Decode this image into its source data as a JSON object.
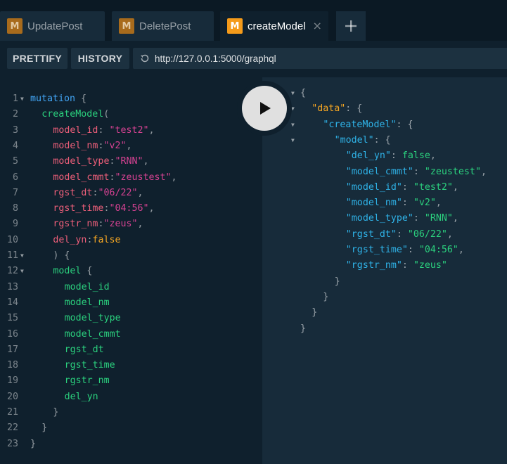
{
  "tabs": [
    {
      "badge": "M",
      "label": "UpdatePost"
    },
    {
      "badge": "M",
      "label": "DeletePost"
    },
    {
      "badge": "M",
      "label": "createModel",
      "close": "×"
    }
  ],
  "toolbar": {
    "prettify_label": "PRETTIFY",
    "history_label": "HISTORY",
    "url": "http://127.0.0.1:5000/graphql"
  },
  "query_lines": [
    {
      "n": "1",
      "fold": true,
      "tokens": [
        [
          "kw",
          "mutation"
        ],
        [
          "pun",
          " {"
        ]
      ]
    },
    {
      "n": "2",
      "fold": false,
      "tokens": [
        [
          "fn",
          "createModel"
        ],
        [
          "pun",
          "("
        ]
      ]
    },
    {
      "n": "3",
      "fold": false,
      "tokens": [
        [
          "arg",
          "model_id"
        ],
        [
          "pun",
          ": "
        ],
        [
          "str",
          "\"test2\""
        ],
        [
          "pun",
          ","
        ]
      ]
    },
    {
      "n": "4",
      "fold": false,
      "tokens": [
        [
          "arg",
          "model_nm"
        ],
        [
          "pun",
          ":"
        ],
        [
          "str",
          "\"v2\""
        ],
        [
          "pun",
          ","
        ]
      ]
    },
    {
      "n": "5",
      "fold": false,
      "tokens": [
        [
          "arg",
          "model_type"
        ],
        [
          "pun",
          ":"
        ],
        [
          "str",
          "\"RNN\""
        ],
        [
          "pun",
          ","
        ]
      ]
    },
    {
      "n": "6",
      "fold": false,
      "tokens": [
        [
          "arg",
          "model_cmmt"
        ],
        [
          "pun",
          ":"
        ],
        [
          "str",
          "\"zeustest\""
        ],
        [
          "pun",
          ","
        ]
      ]
    },
    {
      "n": "7",
      "fold": false,
      "tokens": [
        [
          "arg",
          "rgst_dt"
        ],
        [
          "pun",
          ":"
        ],
        [
          "str",
          "\"06/22\""
        ],
        [
          "pun",
          ","
        ]
      ]
    },
    {
      "n": "8",
      "fold": false,
      "tokens": [
        [
          "arg",
          "rgst_time"
        ],
        [
          "pun",
          ":"
        ],
        [
          "str",
          "\"04:56\""
        ],
        [
          "pun",
          ","
        ]
      ]
    },
    {
      "n": "9",
      "fold": false,
      "tokens": [
        [
          "arg",
          "rgstr_nm"
        ],
        [
          "pun",
          ":"
        ],
        [
          "str",
          "\"zeus\""
        ],
        [
          "pun",
          ","
        ]
      ]
    },
    {
      "n": "10",
      "fold": false,
      "tokens": [
        [
          "arg",
          "del_yn"
        ],
        [
          "pun",
          ":"
        ],
        [
          "bool",
          "false"
        ]
      ]
    },
    {
      "n": "11",
      "fold": true,
      "tokens": [
        [
          "pun",
          ") {"
        ]
      ]
    },
    {
      "n": "12",
      "fold": true,
      "tokens": [
        [
          "field",
          "model"
        ],
        [
          "pun",
          " {"
        ]
      ]
    },
    {
      "n": "13",
      "fold": false,
      "tokens": [
        [
          "field",
          "model_id"
        ]
      ]
    },
    {
      "n": "14",
      "fold": false,
      "tokens": [
        [
          "field",
          "model_nm"
        ]
      ]
    },
    {
      "n": "15",
      "fold": false,
      "tokens": [
        [
          "field",
          "model_type"
        ]
      ]
    },
    {
      "n": "16",
      "fold": false,
      "tokens": [
        [
          "field",
          "model_cmmt"
        ]
      ]
    },
    {
      "n": "17",
      "fold": false,
      "tokens": [
        [
          "field",
          "rgst_dt"
        ]
      ]
    },
    {
      "n": "18",
      "fold": false,
      "tokens": [
        [
          "field",
          "rgst_time"
        ]
      ]
    },
    {
      "n": "19",
      "fold": false,
      "tokens": [
        [
          "field",
          "rgstr_nm"
        ]
      ]
    },
    {
      "n": "20",
      "fold": false,
      "tokens": [
        [
          "field",
          "del_yn"
        ]
      ]
    },
    {
      "n": "21",
      "fold": false,
      "tokens": [
        [
          "pun",
          "}"
        ]
      ]
    },
    {
      "n": "22",
      "fold": false,
      "tokens": [
        [
          "pun",
          "}"
        ]
      ]
    },
    {
      "n": "23",
      "fold": false,
      "tokens": [
        [
          "pun",
          "}"
        ]
      ]
    }
  ],
  "result_lines": [
    {
      "fold": true,
      "tokens": [
        [
          "pun",
          "{"
        ]
      ]
    },
    {
      "fold": true,
      "tokens": [
        [
          "rkey-data",
          "\"data\""
        ],
        [
          "pun",
          ": {"
        ]
      ]
    },
    {
      "fold": true,
      "tokens": [
        [
          "rkey",
          "\"createModel\""
        ],
        [
          "pun",
          ": {"
        ]
      ]
    },
    {
      "fold": true,
      "tokens": [
        [
          "rkey",
          "\"model\""
        ],
        [
          "pun",
          ": {"
        ]
      ]
    },
    {
      "fold": false,
      "tokens": [
        [
          "rkey",
          "\"del_yn\""
        ],
        [
          "pun",
          ": "
        ],
        [
          "rval-bool",
          "false"
        ],
        [
          "pun",
          ","
        ]
      ]
    },
    {
      "fold": false,
      "tokens": [
        [
          "rkey",
          "\"model_cmmt\""
        ],
        [
          "pun",
          ": "
        ],
        [
          "rstr",
          "\"zeustest\""
        ],
        [
          "pun",
          ","
        ]
      ]
    },
    {
      "fold": false,
      "tokens": [
        [
          "rkey",
          "\"model_id\""
        ],
        [
          "pun",
          ": "
        ],
        [
          "rstr",
          "\"test2\""
        ],
        [
          "pun",
          ","
        ]
      ]
    },
    {
      "fold": false,
      "tokens": [
        [
          "rkey",
          "\"model_nm\""
        ],
        [
          "pun",
          ": "
        ],
        [
          "rstr",
          "\"v2\""
        ],
        [
          "pun",
          ","
        ]
      ]
    },
    {
      "fold": false,
      "tokens": [
        [
          "rkey",
          "\"model_type\""
        ],
        [
          "pun",
          ": "
        ],
        [
          "rstr",
          "\"RNN\""
        ],
        [
          "pun",
          ","
        ]
      ]
    },
    {
      "fold": false,
      "tokens": [
        [
          "rkey",
          "\"rgst_dt\""
        ],
        [
          "pun",
          ": "
        ],
        [
          "rstr",
          "\"06/22\""
        ],
        [
          "pun",
          ","
        ]
      ]
    },
    {
      "fold": false,
      "tokens": [
        [
          "rkey",
          "\"rgst_time\""
        ],
        [
          "pun",
          ": "
        ],
        [
          "rstr",
          "\"04:56\""
        ],
        [
          "pun",
          ","
        ]
      ]
    },
    {
      "fold": false,
      "tokens": [
        [
          "rkey",
          "\"rgstr_nm\""
        ],
        [
          "pun",
          ": "
        ],
        [
          "rstr",
          "\"zeus\""
        ]
      ]
    },
    {
      "fold": false,
      "tokens": [
        [
          "pun",
          "}"
        ]
      ]
    },
    {
      "fold": false,
      "tokens": [
        [
          "pun",
          "}"
        ]
      ]
    },
    {
      "fold": false,
      "tokens": [
        [
          "pun",
          "}"
        ]
      ]
    },
    {
      "fold": false,
      "tokens": [
        [
          "pun",
          "}"
        ]
      ]
    }
  ],
  "colors": {
    "accent_badge": "#f59b1a",
    "keyword": "#42a5f5",
    "field": "#2bd17e",
    "argument": "#ef5f7a",
    "string": "#d64292",
    "result_key": "#2fb3e8"
  },
  "icons": {
    "add_tab": "plus-icon",
    "reload": "history-icon",
    "run": "play-icon",
    "fold": "fold-arrow-icon"
  }
}
